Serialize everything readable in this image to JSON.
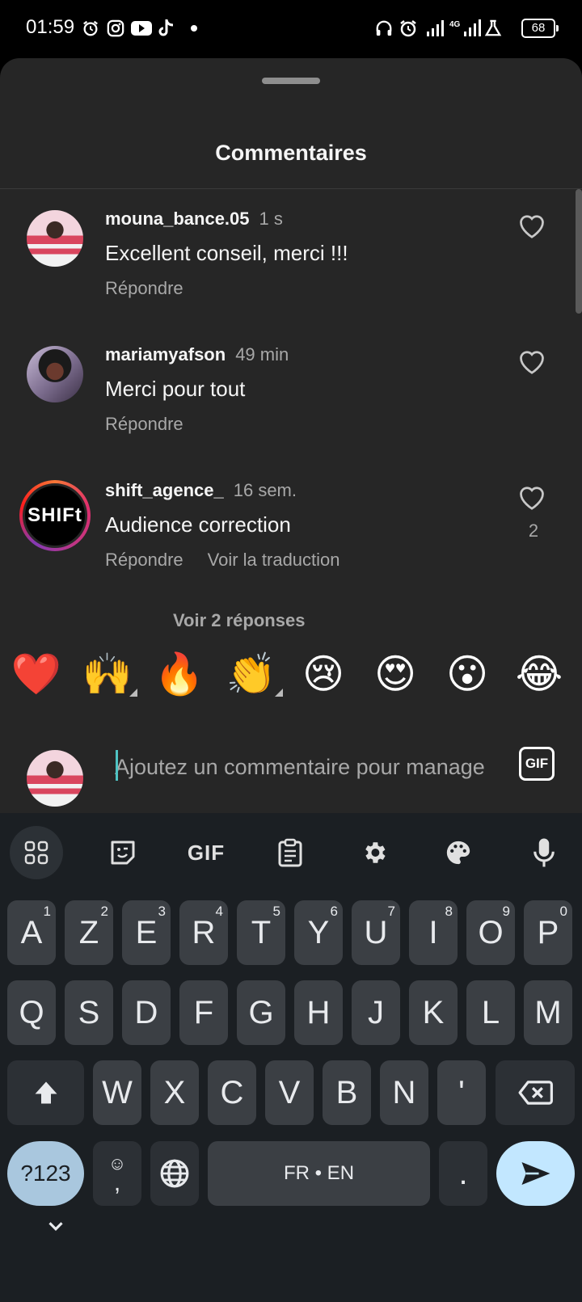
{
  "status_bar": {
    "time": "01:59",
    "battery": "68",
    "network": "4G"
  },
  "sheet": {
    "title": "Commentaires"
  },
  "comments": [
    {
      "username": "mouna_bance.05",
      "time": "1 s",
      "text": "Excellent conseil, merci !!!",
      "reply_label": "Répondre",
      "likes": ""
    },
    {
      "username": "mariamyafson",
      "time": "49 min",
      "text": "Merci pour tout",
      "reply_label": "Répondre",
      "likes": ""
    },
    {
      "username": "shift_agence_",
      "time": "16 sem.",
      "text": "Audience correction",
      "reply_label": "Répondre",
      "translate_label": "Voir la traduction",
      "likes": "2",
      "avatar_text": "SHIFt"
    }
  ],
  "view_replies": "Voir 2 réponses",
  "emoji_bar": [
    "❤️",
    "🙌",
    "🔥",
    "👏",
    "😢",
    "😍",
    "😮",
    "😂"
  ],
  "composer": {
    "placeholder": "Ajoutez un commentaire pour manage",
    "gif_label": "GIF"
  },
  "keyboard": {
    "toolbar_gif": "GIF",
    "row1": [
      {
        "key": "A",
        "hint": "1"
      },
      {
        "key": "Z",
        "hint": "2"
      },
      {
        "key": "E",
        "hint": "3"
      },
      {
        "key": "R",
        "hint": "4"
      },
      {
        "key": "T",
        "hint": "5"
      },
      {
        "key": "Y",
        "hint": "6"
      },
      {
        "key": "U",
        "hint": "7"
      },
      {
        "key": "I",
        "hint": "8"
      },
      {
        "key": "O",
        "hint": "9"
      },
      {
        "key": "P",
        "hint": "0"
      }
    ],
    "row2": [
      "Q",
      "S",
      "D",
      "F",
      "G",
      "H",
      "J",
      "K",
      "L",
      "M"
    ],
    "row3": [
      "W",
      "X",
      "C",
      "V",
      "B",
      "N",
      "'"
    ],
    "symbols": "?123",
    "comma": ",",
    "space": "FR • EN",
    "period": "."
  },
  "colors": {
    "sheet_bg": "#262626",
    "keyboard_bg": "#1b1f23",
    "key_bg": "#3b3f44",
    "accent_blue": "#c2e7ff"
  }
}
